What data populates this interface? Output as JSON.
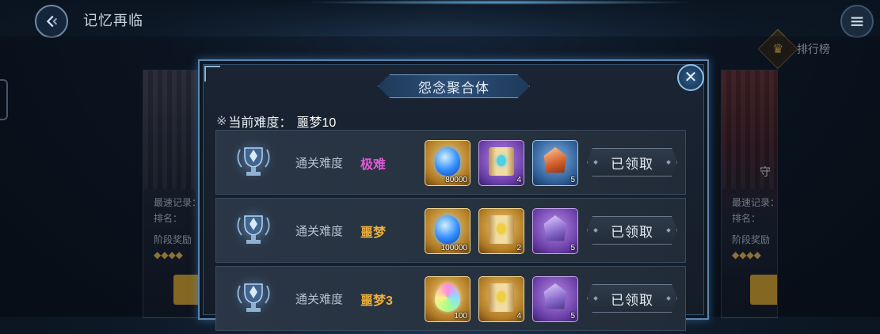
{
  "header": {
    "title": "记忆再临"
  },
  "ranking": {
    "label": "排行榜"
  },
  "left_card": {
    "record_label": "最速记录：",
    "rank_label": "排名：",
    "reward_label": "阶段奖励",
    "diamonds": "◆◆◆◆"
  },
  "right_card": {
    "record_label": "最速记录：",
    "rank_label": "排名：",
    "reward_label": "阶段奖励",
    "diamonds": "◆◆◆◆",
    "banner_text": "守"
  },
  "dialog": {
    "title": "怨念聚合体",
    "current_difficulty_mark": "※",
    "current_difficulty_label": "当前难度：",
    "current_difficulty_value": "噩梦10",
    "rows": [
      {
        "label": "通关难度",
        "level": "极难",
        "level_color": "#e15ad6",
        "items": [
          {
            "icon": "blue-essence-icon",
            "frame": "gold",
            "count": "80000"
          },
          {
            "icon": "skill-scroll-icon",
            "frame": "purple",
            "count": "4"
          },
          {
            "icon": "orange-crystal-icon",
            "frame": "blue",
            "count": "5"
          }
        ],
        "button": "已领取"
      },
      {
        "label": "通关难度",
        "level": "噩梦",
        "level_color": "#f0b13a",
        "items": [
          {
            "icon": "blue-essence-icon",
            "frame": "gold",
            "count": "100000"
          },
          {
            "icon": "gold-scroll-icon",
            "frame": "gold",
            "count": "2"
          },
          {
            "icon": "violet-crystal-icon",
            "frame": "purple",
            "count": "5"
          }
        ],
        "button": "已领取"
      },
      {
        "label": "通关难度",
        "level": "噩梦3",
        "level_color": "#f0b13a",
        "items": [
          {
            "icon": "rainbow-drop-icon",
            "frame": "gold",
            "count": "100"
          },
          {
            "icon": "gold-scroll-icon",
            "frame": "gold",
            "count": "4"
          },
          {
            "icon": "violet-crystal-icon",
            "frame": "purple",
            "count": "5"
          }
        ],
        "button": "已领取"
      }
    ]
  }
}
